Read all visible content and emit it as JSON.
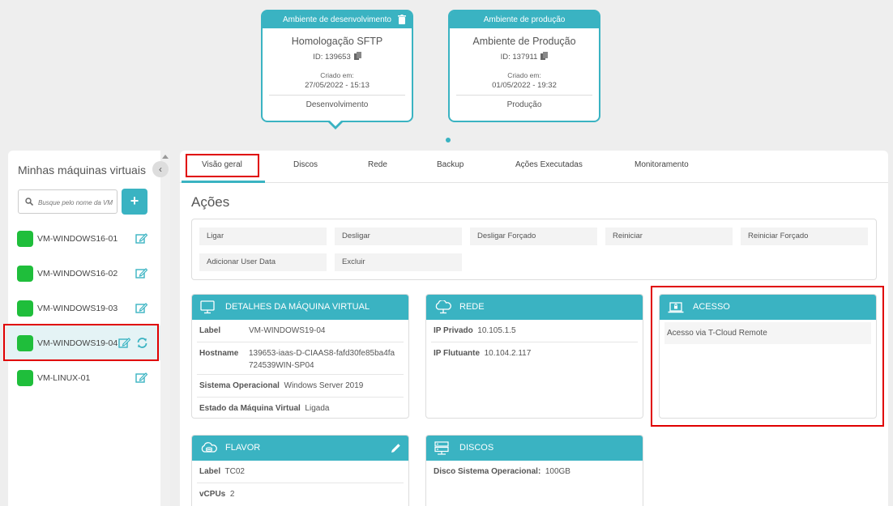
{
  "environments": [
    {
      "header": "Ambiente de desenvolvimento",
      "name": "Homologação SFTP",
      "id": "ID: 139653",
      "created_label": "Criado em:",
      "created": "27/05/2022 - 15:13",
      "type": "Desenvolvimento",
      "selected": true
    },
    {
      "header": "Ambiente de produção",
      "name": "Ambiente de Produção",
      "id": "ID: 137911",
      "created_label": "Criado em:",
      "created": "01/05/2022 - 19:32",
      "type": "Produção",
      "selected": false
    }
  ],
  "sidebar": {
    "title": "Minhas máquinas virtuais",
    "search_placeholder": "Busque pelo nome da VM",
    "add_label": "+",
    "vms": [
      {
        "name": "VM-WINDOWS16-01",
        "status_color": "#1fbe3b"
      },
      {
        "name": "VM-WINDOWS16-02",
        "status_color": "#1fbe3b"
      },
      {
        "name": "VM-WINDOWS19-03",
        "status_color": "#1fbe3b"
      },
      {
        "name": "VM-WINDOWS19-04",
        "status_color": "#1fbe3b",
        "active": true
      },
      {
        "name": "VM-LINUX-01",
        "status_color": "#1fbe3b"
      }
    ]
  },
  "tabs": [
    "Visão geral",
    "Discos",
    "Rede",
    "Backup",
    "Ações Executadas",
    "Monitoramento"
  ],
  "active_tab": "Visão geral",
  "actions_title": "Ações",
  "actions": [
    "Ligar",
    "Desligar",
    "Desligar Forçado",
    "Reiniciar",
    "Reiniciar Forçado",
    "Adicionar User Data",
    "Excluir"
  ],
  "details": {
    "title": "DETALHES DA MÁQUINA VIRTUAL",
    "label_k": "Label",
    "label_v": "VM-WINDOWS19-04",
    "hostname_k": "Hostname",
    "hostname_v": "139653-iaas-D-CIAAS8-fafd30fe85ba4fa724539WIN-SP04",
    "os_k": "Sistema Operacional",
    "os_v": "Windows Server 2019",
    "state_k": "Estado da Máquina Virtual",
    "state_v": "Ligada"
  },
  "network": {
    "title": "REDE",
    "private_k": "IP Privado",
    "private_v": "10.105.1.5",
    "floating_k": "IP Flutuante",
    "floating_v": "10.104.2.117"
  },
  "access": {
    "title": "ACESSO",
    "text": "Acesso via T-Cloud Remote"
  },
  "flavor": {
    "title": "FLAVOR",
    "label_k": "Label",
    "label_v": "TC02",
    "vcpus_k": "vCPUs",
    "vcpus_v": "2"
  },
  "disks": {
    "title": "DISCOS",
    "os_disk_k": "Disco Sistema Operacional:",
    "os_disk_v": "100GB"
  },
  "colors": {
    "accent": "#3ab3c2",
    "status_on": "#1fbe3b",
    "highlight": "#e00000"
  }
}
